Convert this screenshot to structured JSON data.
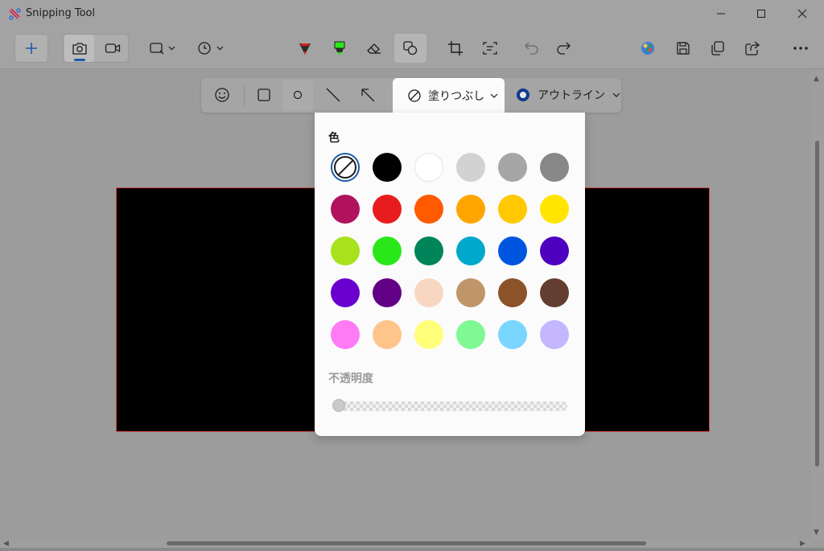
{
  "window": {
    "title": "Snipping Tool"
  },
  "toolbar": {
    "left": [
      "new-icon",
      "camera-icon",
      "video-icon",
      "snip-shape-icon",
      "delay-timer-icon"
    ],
    "center": [
      "red-pen-icon",
      "green-highlighter-icon",
      "eraser-icon",
      "shapes-icon",
      "crop-icon",
      "text-actions-icon",
      "undo-icon",
      "redo-icon"
    ],
    "right": [
      "paint-icon",
      "save-icon",
      "copy-icon",
      "share-icon",
      "more-icon"
    ]
  },
  "shapes": {
    "tools": [
      "emoji-icon",
      "rectangle-icon",
      "circle-icon",
      "line-icon",
      "arrow-icon"
    ],
    "fill_label": "塗りつぶし",
    "outline_label": "アウトライン",
    "outline_color": "#0f3a8a"
  },
  "color_popup": {
    "title": "色",
    "opacity_label": "不透明度",
    "opacity_value": 0,
    "selected": "none",
    "colors": [
      "none",
      "#000000",
      "#ffffff",
      "#d2d2d2",
      "#a6a6a6",
      "#888888",
      "#b0125e",
      "#e81c1c",
      "#ff5a00",
      "#ffa500",
      "#ffc800",
      "#ffe500",
      "#a7e21d",
      "#2ae71a",
      "#00855a",
      "#00a9cc",
      "#0055e0",
      "#4e00c0",
      "#6a00d0",
      "#620086",
      "#f8d7c2",
      "#bf956a",
      "#8c5229",
      "#633d2f",
      "#ff7af5",
      "#ffc48a",
      "#ffff7a",
      "#80f894",
      "#7ad6ff",
      "#c4b6ff"
    ]
  }
}
